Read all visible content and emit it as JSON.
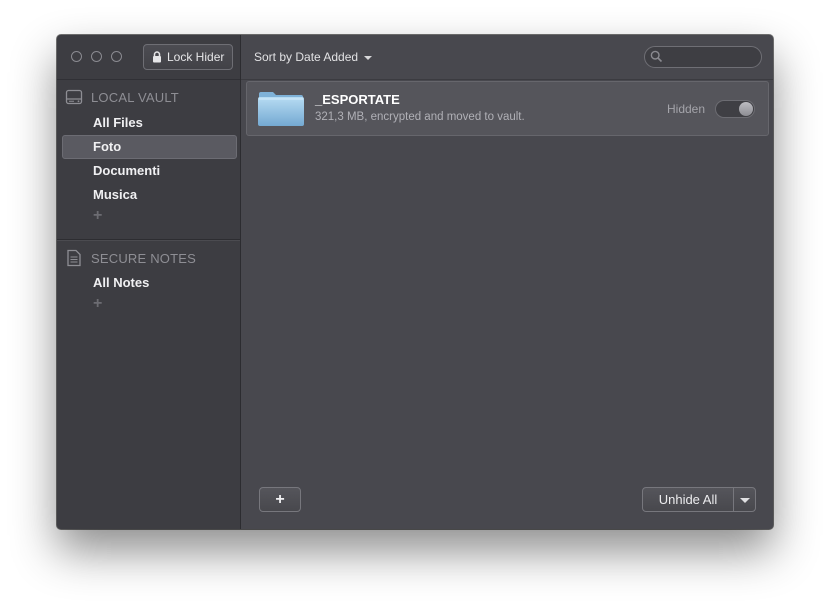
{
  "toolbar": {
    "lock_label": "Lock Hider",
    "sort_label": "Sort by Date Added",
    "search_placeholder": ""
  },
  "sidebar": {
    "local_vault": {
      "title": "LOCAL VAULT",
      "items": [
        {
          "label": "All Files",
          "selected": false
        },
        {
          "label": "Foto",
          "selected": true
        },
        {
          "label": "Documenti",
          "selected": false
        },
        {
          "label": "Musica",
          "selected": false
        }
      ],
      "add_label": "+"
    },
    "secure_notes": {
      "title": "SECURE NOTES",
      "items": [
        {
          "label": "All Notes",
          "selected": false
        }
      ],
      "add_label": "+"
    }
  },
  "files": [
    {
      "name": "_ESPORTATE",
      "description": "321,3 MB, encrypted and moved to vault.",
      "status_label": "Hidden",
      "toggle_on": true,
      "icon": "folder-icon"
    }
  ],
  "footer": {
    "add_label": "+",
    "unhide_label": "Unhide All"
  },
  "colors": {
    "window_bg": "#48484e",
    "sidebar_bg": "#3d3d42",
    "selected_bg": "#5a5a61",
    "folder_blue": "#8fbfe0"
  }
}
